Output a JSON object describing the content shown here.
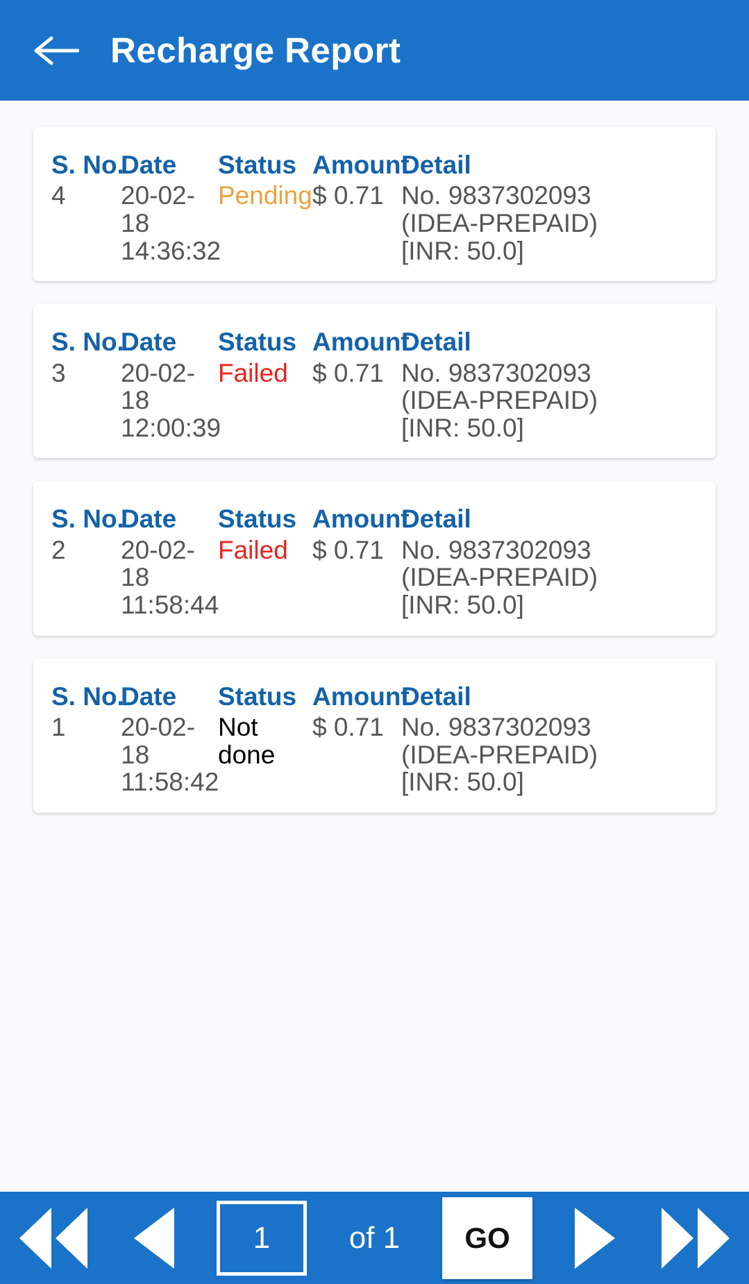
{
  "header": {
    "back_icon": "back-arrow-icon",
    "title": "Recharge Report",
    "bg_color": "#1a73c8"
  },
  "table": {
    "columns": {
      "sno": "S. No.",
      "date": "Date",
      "status": "Status",
      "amount": "Amount",
      "detail": "Detail"
    },
    "header_color": "#1462a8",
    "status_colors": {
      "Pending": "#e8a33d",
      "Failed": "#e8241c",
      "Not done": "#000000"
    }
  },
  "records": [
    {
      "sno": "4",
      "date": "20-02-18\n14:36:32",
      "status": "Pending",
      "status_class": "status-pending",
      "amount": "$ 0.71",
      "detail": "No. 9837302093\n(IDEA-PREPAID)\n[INR: 50.0]"
    },
    {
      "sno": "3",
      "date": "20-02-18\n12:00:39",
      "status": "Failed",
      "status_class": "status-failed",
      "amount": "$ 0.71",
      "detail": "No. 9837302093\n(IDEA-PREPAID)\n[INR: 50.0]"
    },
    {
      "sno": "2",
      "date": "20-02-18\n11:58:44",
      "status": "Failed",
      "status_class": "status-failed",
      "amount": "$ 0.71",
      "detail": "No. 9837302093\n(IDEA-PREPAID)\n[INR: 50.0]"
    },
    {
      "sno": "1",
      "date": "20-02-18\n11:58:42",
      "status": "Not done",
      "status_class": "status-plain",
      "amount": "$ 0.71",
      "detail": "No. 9837302093\n(IDEA-PREPAID)\n[INR: 50.0]"
    }
  ],
  "pagination": {
    "first_icon": "double-left-arrow-icon",
    "prev_icon": "left-arrow-icon",
    "current_page": "1",
    "of_label": "of 1",
    "total_pages": "1",
    "go_label": "GO",
    "next_icon": "right-arrow-icon",
    "last_icon": "double-right-arrow-icon",
    "bg_color": "#1a73c8"
  }
}
